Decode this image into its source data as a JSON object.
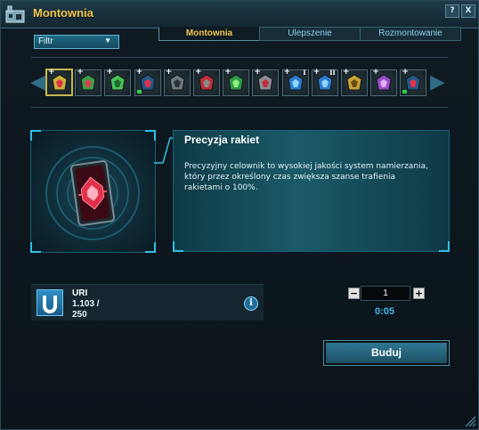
{
  "window": {
    "title": "Montownia",
    "help_label": "?",
    "close_label": "X"
  },
  "filter": {
    "label": "Filtr",
    "arrow": "▼"
  },
  "tabs": [
    {
      "label": "Montownia",
      "active": true
    },
    {
      "label": "Ulepszenie",
      "active": false
    },
    {
      "label": "Rozmontowanie",
      "active": false
    }
  ],
  "strip": {
    "left_arrow": "◀",
    "right_arrow": "▶",
    "items": [
      {
        "icon": "precision-rocket-module-icon",
        "plus": "+",
        "selected": true
      },
      {
        "icon": "green-shield-module-icon",
        "plus": "+"
      },
      {
        "icon": "green-claw-module-icon",
        "plus": "+"
      },
      {
        "icon": "red-module-icon",
        "plus": "+",
        "level_badge": true
      },
      {
        "icon": "grey-turret-module-icon",
        "plus": "+"
      },
      {
        "icon": "red-x-module-icon",
        "plus": "+"
      },
      {
        "icon": "green-orb-module-icon",
        "plus": "+"
      },
      {
        "icon": "crossed-blades-module-icon",
        "plus": "+"
      },
      {
        "icon": "blue-module-icon",
        "plus": "+",
        "roman": "I"
      },
      {
        "icon": "blue-module-icon",
        "plus": "+",
        "roman": "II"
      },
      {
        "icon": "gold-module-icon",
        "plus": "+"
      },
      {
        "icon": "purple-blade-module-icon",
        "plus": "+"
      },
      {
        "icon": "red-module-icon",
        "plus": "+",
        "level_badge": true
      }
    ]
  },
  "item": {
    "name": "Precyzja rakiet",
    "description": "Precyzyjny celownik to wysokiej jakości system namierzania, który przez określony czas zwiększa szanse trafienia rakietami o 100%."
  },
  "resource": {
    "name": "URI",
    "amount": "1.103 /",
    "required": "250",
    "info": "i"
  },
  "quantity": {
    "value": "1",
    "minus": "−",
    "plus": "+"
  },
  "time": "0:05",
  "build_button": "Buduj",
  "colors": {
    "accent_gold": "#f2c84b",
    "cyan": "#43b7ea",
    "panel_teal": "#1a5a68"
  }
}
